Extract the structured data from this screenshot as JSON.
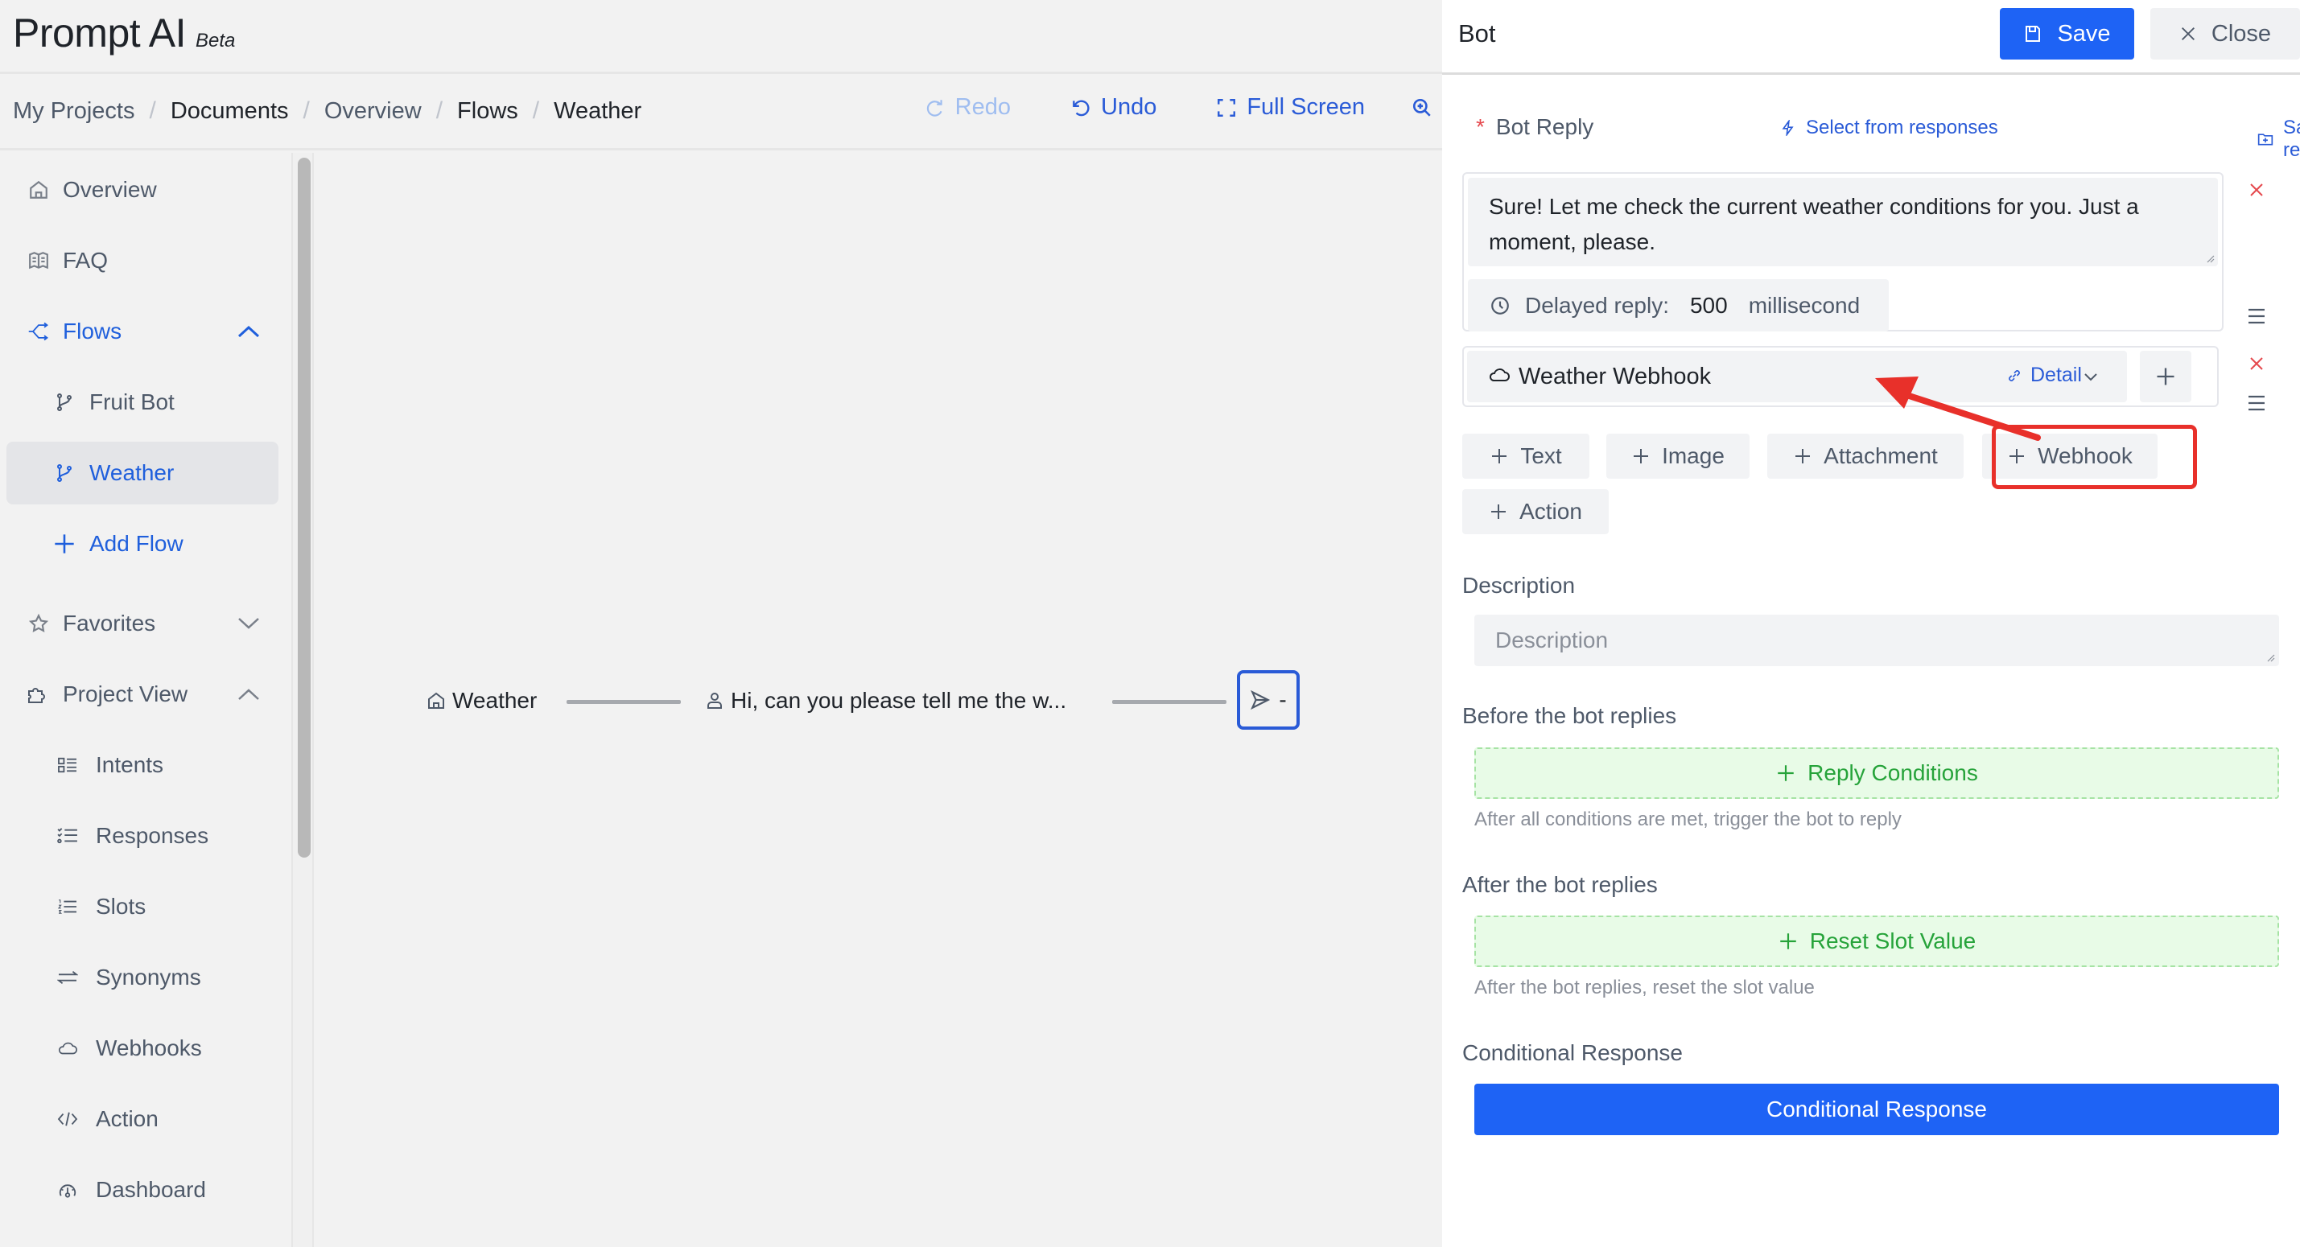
{
  "app": {
    "title": "Prompt AI",
    "badge": "Beta"
  },
  "breadcrumb": [
    "My Projects",
    "Documents",
    "Overview",
    "Flows",
    "Weather"
  ],
  "toolbar": {
    "redo": "Redo",
    "undo": "Undo",
    "full_screen": "Full Screen",
    "zoom_icon": "zoom-in-icon"
  },
  "sidebar": {
    "overview": "Overview",
    "faq": "FAQ",
    "flows": "Flows",
    "flow_items": [
      "Fruit Bot",
      "Weather"
    ],
    "add_flow": "Add Flow",
    "favorites": "Favorites",
    "project_view": "Project View",
    "project_items": [
      "Intents",
      "Responses",
      "Slots",
      "Synonyms",
      "Webhooks",
      "Action",
      "Dashboard"
    ],
    "active_item": "Weather"
  },
  "canvas": {
    "start_node": "Weather",
    "user_node": "Hi, can you please tell me the w...",
    "bot_node": "-"
  },
  "drawer": {
    "title": "Bot",
    "save": "Save",
    "close": "Close",
    "bot_reply_label": "Bot Reply",
    "required_mark": "*",
    "select_from_responses": "Select from responses",
    "save_to_responses": "Save to responses",
    "reply_text": "Sure! Let me check the current weather conditions for you. Just a moment, please.",
    "delayed_reply_label": "Delayed reply:",
    "delayed_reply_value": "500",
    "delayed_reply_unit": "millisecond",
    "webhook_name": "Weather Webhook",
    "webhook_detail": "Detail",
    "add_buttons": [
      "Text",
      "Image",
      "Attachment",
      "Webhook",
      "Action"
    ],
    "highlighted_button": "Webhook",
    "description_label": "Description",
    "description_placeholder": "Description",
    "description_value": "",
    "before_label": "Before the bot replies",
    "reply_conditions": "Reply Conditions",
    "before_hint": "After all conditions are met, trigger the bot to reply",
    "after_label": "After the bot replies",
    "reset_slot_value": "Reset Slot Value",
    "after_hint": "After the bot replies, reset the slot value",
    "conditional_label": "Conditional Response",
    "conditional_button": "Conditional Response"
  },
  "colors": {
    "primary": "#1e63f5",
    "link": "#2a5bd7",
    "danger": "#e5484d",
    "success": "#26a33a",
    "annotation": "#e8302a"
  }
}
